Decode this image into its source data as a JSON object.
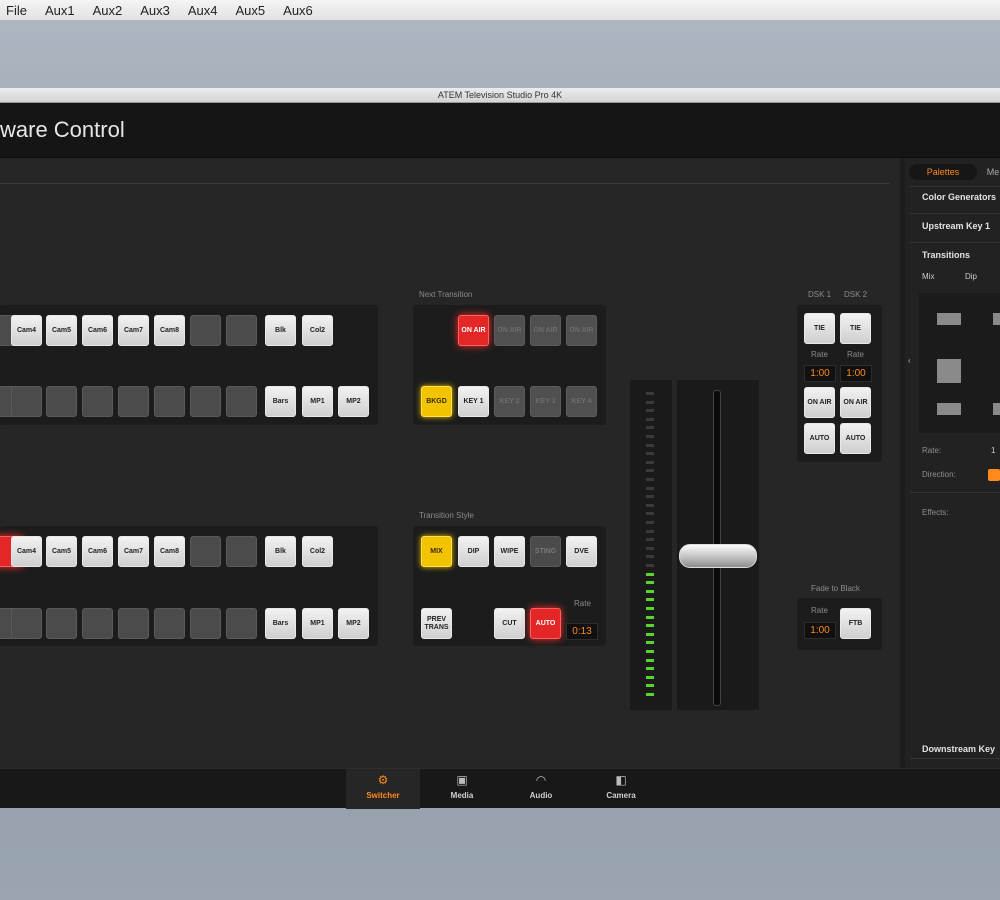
{
  "menubar": {
    "items": [
      "File",
      "Aux1",
      "Aux2",
      "Aux3",
      "Aux4",
      "Aux5",
      "Aux6"
    ]
  },
  "window": {
    "title": "ATEM Television Studio Pro 4K",
    "app_title": "ware Control"
  },
  "program_row": [
    "",
    "Cam4",
    "Cam5",
    "Cam6",
    "Cam7",
    "Cam8",
    "",
    "",
    "Blk",
    "Col2"
  ],
  "program_row2": [
    "",
    "",
    "",
    "",
    "",
    "",
    "",
    "",
    "Bars",
    "MP1",
    "MP2"
  ],
  "preview_row": [
    "",
    "Cam4",
    "Cam5",
    "Cam6",
    "Cam7",
    "Cam8",
    "",
    "",
    "Blk",
    "Col2"
  ],
  "preview_row2": [
    "",
    "",
    "",
    "",
    "",
    "",
    "",
    "",
    "Bars",
    "MP1",
    "MP2"
  ],
  "next_transition": {
    "label": "Next Transition",
    "on_air": "ON AIR",
    "bkgd": "BKGD",
    "key1": "KEY 1",
    "key2": "KEY 2",
    "key3": "KEY 3",
    "key4": "KEY 4"
  },
  "transition_style": {
    "label": "Transition Style",
    "mix": "MIX",
    "dip": "DIP",
    "wipe": "WIPE",
    "sting": "STING",
    "dve": "DVE",
    "prev_trans": "PREV TRANS",
    "cut": "CUT",
    "auto": "AUTO",
    "rate_label": "Rate",
    "rate_value": "0:13"
  },
  "dsk": {
    "dsk1_label": "DSK 1",
    "dsk2_label": "DSK 2",
    "tie": "TIE",
    "rate_label": "Rate",
    "rate1": "1:00",
    "rate2": "1:00",
    "on_air": "ON AIR",
    "auto": "AUTO"
  },
  "fade_to_black": {
    "label": "Fade to Black",
    "rate_label": "Rate",
    "rate": "1:00",
    "ftb": "FTB"
  },
  "palette": {
    "tab_palettes": "Palettes",
    "tab_media": "Me",
    "color_generators": "Color Generators",
    "upstream_key": "Upstream Key 1",
    "transitions": "Transitions",
    "sub_tab_mix": "Mix",
    "sub_tab_dip": "Dip",
    "rate_label": "Rate:",
    "rate_value": "1",
    "direction_label": "Direction:",
    "effects_label": "Effects:",
    "downstream_key": "Downstream Key"
  },
  "bottom_nav": [
    {
      "label": "Switcher",
      "icon": "switcher-icon",
      "glyph": "⚙"
    },
    {
      "label": "Media",
      "icon": "media-icon",
      "glyph": "▣"
    },
    {
      "label": "Audio",
      "icon": "audio-icon",
      "glyph": "◠"
    },
    {
      "label": "Camera",
      "icon": "camera-icon",
      "glyph": "◧"
    }
  ],
  "fader": {
    "position": 0.5,
    "meter_level": 0.42
  },
  "colors": {
    "accent": "#ff8a1c",
    "on_air_red": "#e32626",
    "preview_yellow": "#f2c400",
    "meter_green": "#54d62c"
  }
}
